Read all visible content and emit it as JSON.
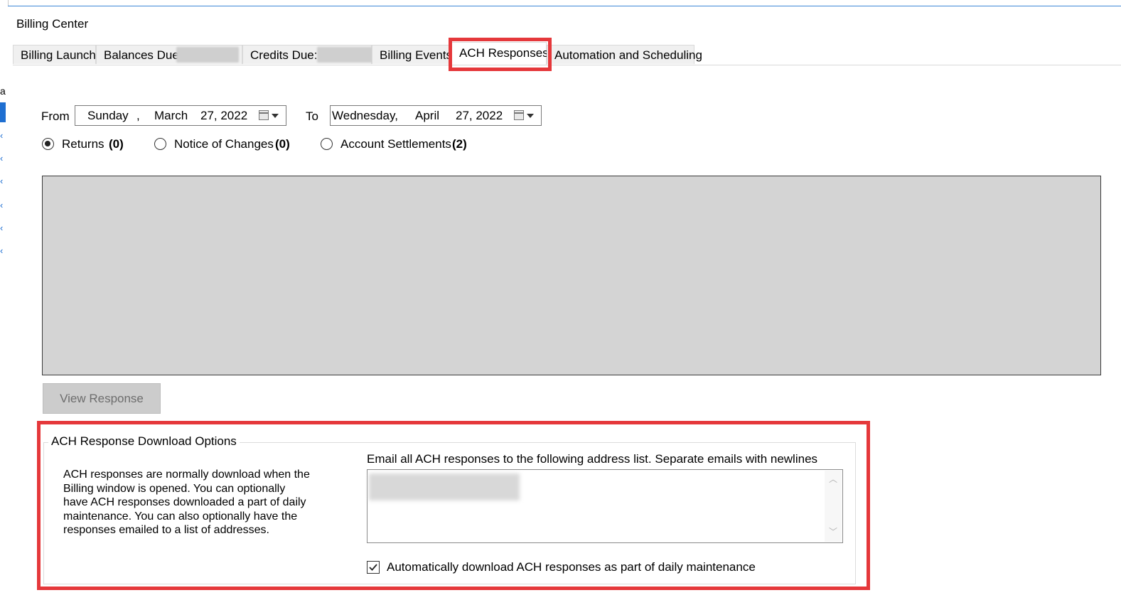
{
  "window": {
    "title": "Billing Center"
  },
  "tabs": [
    {
      "label": "Billing Launch"
    },
    {
      "label": "Balances Due"
    },
    {
      "label": "Credits Due:"
    },
    {
      "label": "Billing Events"
    },
    {
      "label": "ACH Responses",
      "active": true
    },
    {
      "label": "Automation and Scheduling"
    }
  ],
  "filters": {
    "from_label": "From",
    "from_date": {
      "day": "Sunday",
      "sep": ",",
      "month": "March",
      "date": "27, 2022"
    },
    "to_label": "To",
    "to_date": {
      "day": "Wednesday,",
      "month": "April",
      "date": "27, 2022"
    }
  },
  "radios": [
    {
      "label": "Returns",
      "count": "(0)",
      "checked": true
    },
    {
      "label": "Notice of Changes",
      "count": "(0)",
      "checked": false
    },
    {
      "label": "Account Settlements",
      "count": "(2)",
      "checked": false
    }
  ],
  "view_button": "View Response",
  "download_options": {
    "title": "ACH Response Download Options",
    "description": [
      "ACH responses are normally download when the",
      "Billing window is opened.  You can optionally",
      "have ACH responses downloaded a part of daily",
      "maintenance.  You can also optionally have the",
      "responses emailed to a list of addresses."
    ],
    "email_label": "Email all ACH responses to the following address list.  Separate emails with newlines",
    "auto_download_label": "Automatically download ACH responses as part of daily maintenance",
    "auto_download_checked": true
  },
  "left_strip": {
    "partial_text": "a"
  },
  "colors": {
    "highlight": "#e5383b",
    "accent": "#1f6fd1"
  }
}
